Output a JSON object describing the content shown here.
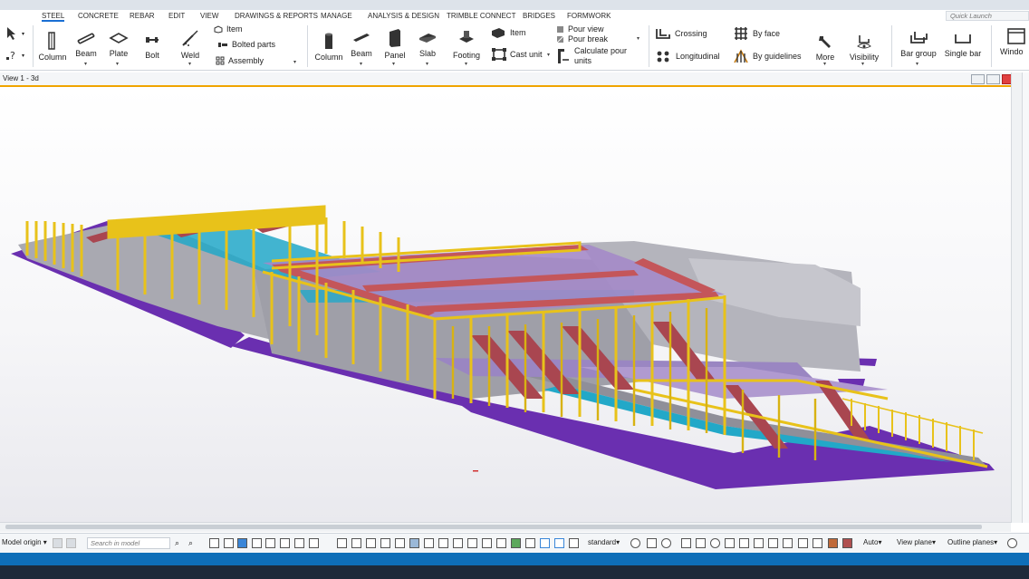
{
  "menu": {
    "tabs": [
      "STEEL",
      "CONCRETE",
      "REBAR",
      "EDIT",
      "VIEW",
      "DRAWINGS & REPORTS",
      "MANAGE",
      "ANALYSIS & DESIGN",
      "TRIMBLE CONNECT",
      "BRIDGES",
      "FORMWORK"
    ],
    "active_tab": "STEEL",
    "quick_launch_placeholder": "Quick Launch"
  },
  "ribbon": {
    "steel": {
      "column": "Column",
      "beam": "Beam",
      "plate": "Plate",
      "bolt": "Bolt",
      "weld": "Weld",
      "item": "Item",
      "bolted_parts": "Bolted parts",
      "assembly": "Assembly"
    },
    "concrete": {
      "column": "Column",
      "beam": "Beam",
      "panel": "Panel",
      "slab": "Slab",
      "footing": "Footing",
      "item": "Item",
      "cast_unit": "Cast unit",
      "pour_view": "Pour view",
      "pour_break": "Pour break",
      "calculate_pour_units_1": "Calculate pour",
      "calculate_pour_units_2": "units"
    },
    "rebar": {
      "crossing": "Crossing",
      "longitudinal": "Longitudinal",
      "by_face": "By face",
      "by_guidelines": "By guidelines",
      "more": "More",
      "visibility": "Visibility",
      "bar_group": "Bar group",
      "single_bar": "Single bar",
      "window": "Windo"
    }
  },
  "view": {
    "title": "View 1 - 3d"
  },
  "statusbar": {
    "origin": "Model origin",
    "search_placeholder": "Search in model",
    "standard": "standard",
    "auto": "Auto",
    "view_plane": "View plane",
    "outline_planes": "Outline planes"
  },
  "colors": {
    "steel_yellow": "#e8c21a",
    "beam_red": "#c4565a",
    "slab_purple": "#6a2fb0",
    "concrete_grey": "#a9a9b1",
    "deck_lilac": "#a48ac8",
    "channel_cyan": "#22a8c8",
    "accent_blue": "#1a6fd4",
    "view_underline": "#f0a400"
  }
}
